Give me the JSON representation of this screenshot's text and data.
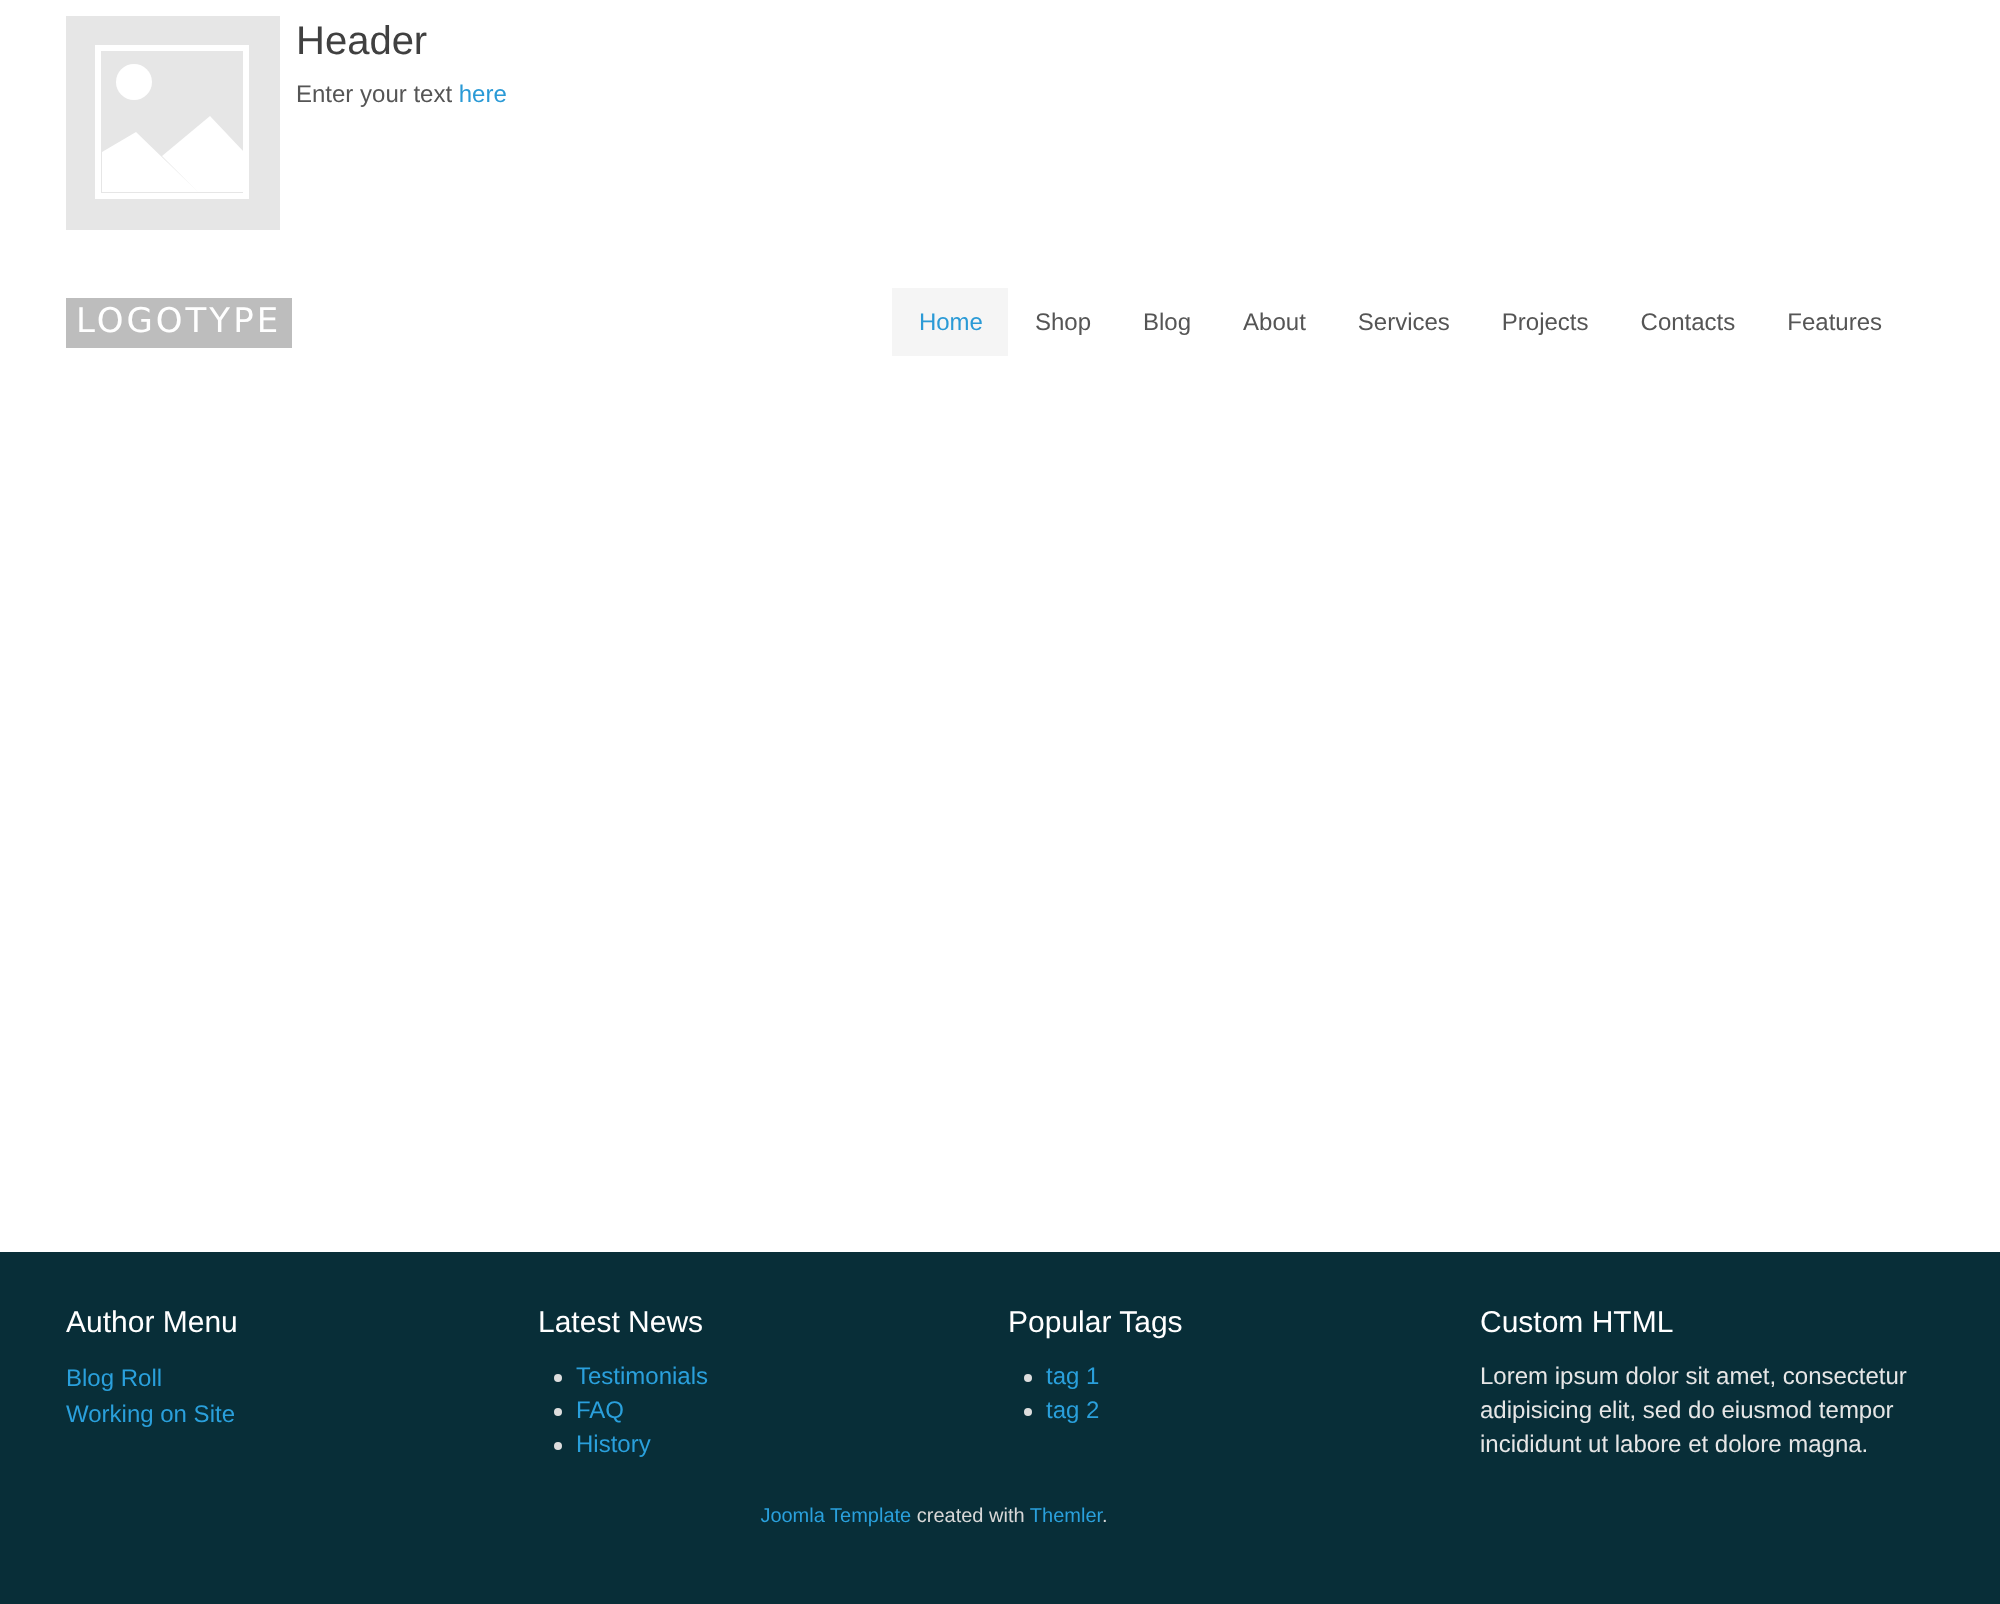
{
  "header": {
    "title": "Header",
    "text": [
      {
        "kind": "text",
        "text": "Enter your text "
      },
      {
        "kind": "link",
        "text": "here"
      }
    ]
  },
  "logo": "LOGOTYPE",
  "nav": [
    {
      "label": "Home",
      "selected": true
    },
    {
      "label": "Shop",
      "selected": false
    },
    {
      "label": "Blog",
      "selected": false
    },
    {
      "label": "About",
      "selected": false
    },
    {
      "label": "Services",
      "selected": false
    },
    {
      "label": "Projects",
      "selected": false
    },
    {
      "label": "Contacts",
      "selected": false
    },
    {
      "label": "Features",
      "selected": false
    }
  ],
  "footer": {
    "columns": [
      {
        "title": "Author Menu",
        "kind": "links",
        "items": [
          "Blog Roll",
          "Working on Site"
        ]
      },
      {
        "title": "Latest News",
        "kind": "bullets",
        "items": [
          "Testimonials",
          "FAQ",
          "History"
        ]
      },
      {
        "title": "Popular Tags",
        "kind": "bullets",
        "items": [
          "tag 1",
          "tag 2"
        ]
      },
      {
        "title": "Custom HTML",
        "kind": "text",
        "text": "Lorem ipsum dolor sit amet, consectetur adipisicing elit, sed do eiusmod tempor incididunt ut labore et dolore magna."
      }
    ],
    "credit": [
      {
        "kind": "link",
        "text": "Joomla Template"
      },
      {
        "kind": "text",
        "text": " created with "
      },
      {
        "kind": "link",
        "text": "Themler"
      },
      {
        "kind": "text",
        "text": "."
      }
    ]
  }
}
